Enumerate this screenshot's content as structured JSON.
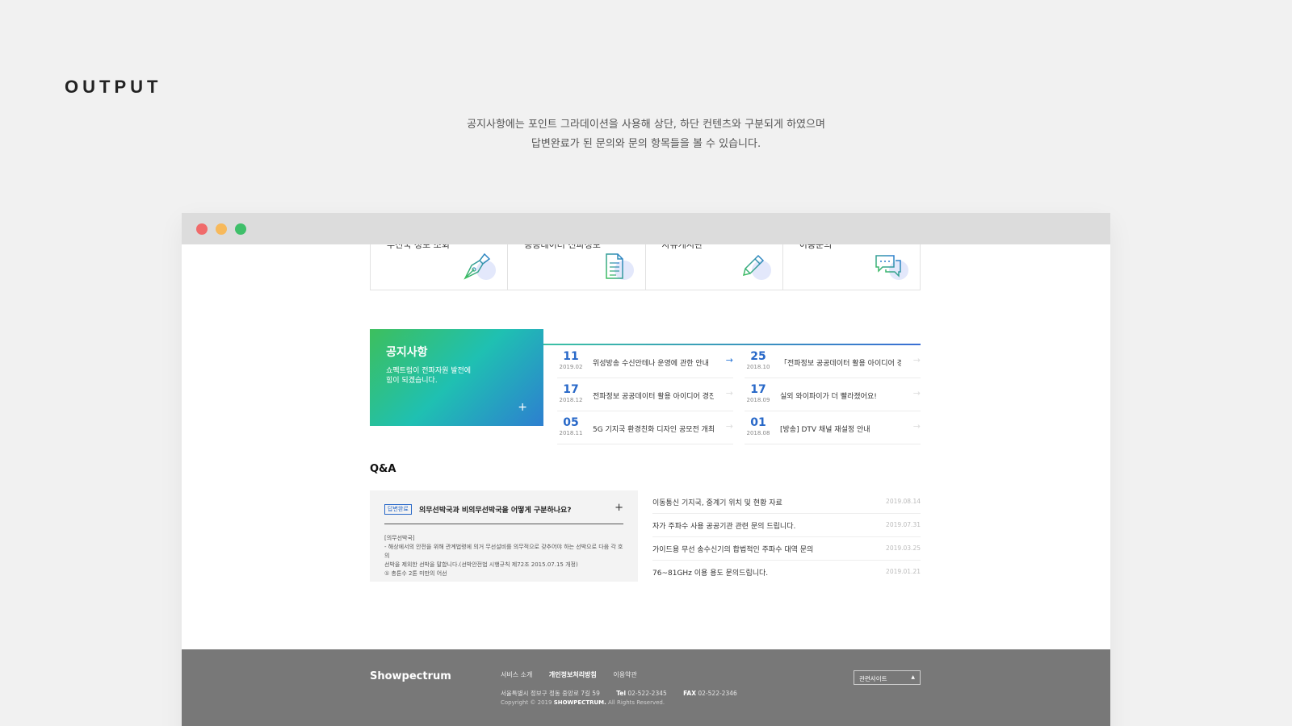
{
  "heading": "OUTPUT",
  "description": {
    "line1": "공지사항에는 포인트 그라데이션을 사용해 상단, 하단 컨텐츠와 구분되게 하였으며",
    "line2": "답변완료가 된 문의와 문의 항목들을 볼 수 있습니다."
  },
  "quick_cards": [
    {
      "label": "무선국 정보 조회",
      "icon": "pen-nib-icon"
    },
    {
      "label": "공공데이터 전파정보",
      "icon": "document-icon"
    },
    {
      "label": "자유게시판",
      "icon": "pencil-icon"
    },
    {
      "label": "이용문의",
      "icon": "chat-bubbles-icon"
    }
  ],
  "notice": {
    "title": "공지사항",
    "subtitle": "쇼펙트럼이 전파자원 발전에 힘이 되겠습니다.",
    "plus": "+",
    "column1": [
      {
        "day": "11",
        "ym": "2019.02",
        "text": "위성방송 수신안테나 운영에 관한 안내",
        "arrow": "→"
      },
      {
        "day": "17",
        "ym": "2018.12",
        "text": "전파정보 공공데이터 활용 아이디어 경진..",
        "arrow": "→"
      },
      {
        "day": "05",
        "ym": "2018.11",
        "text": "5G 기지국 환경친화 디자인 공모전 개최",
        "arrow": "→"
      }
    ],
    "column2": [
      {
        "day": "25",
        "ym": "2018.10",
        "text": "「전파정보 공공데이터 활용 아이디어 경진..",
        "arrow": "→"
      },
      {
        "day": "17",
        "ym": "2018.09",
        "text": "실외 와이파이가 더 빨라졌어요!",
        "arrow": "→"
      },
      {
        "day": "01",
        "ym": "2018.08",
        "text": "[방송] DTV 채널 재설정 안내",
        "arrow": "→"
      }
    ]
  },
  "qa": {
    "title": "Q&A",
    "featured": {
      "badge": "답변완료",
      "question": "의무선박국과 비의무선박국을 어떻게 구분하나요?",
      "plus": "+",
      "body1": "[의무선박국]",
      "body2": "- 해상에서의 안전을 위해 관계법령에 의거 무선설비를 의무적으로 갖추어야 하는 선박으로 다음 각 호의",
      "body3": "선박을 제외한 선박을 말합니다.(선박안전법 시행규칙 제72조 2015.07.15 개정)",
      "body4": "① 총톤수 2톤 미만의 어선"
    },
    "items": [
      {
        "text": "이동통신 기지국, 중계기 위치 및 현황 자료",
        "date": "2019.08.14"
      },
      {
        "text": "자가 주파수 사용 공공기관 관련 문의 드립니다.",
        "date": "2019.07.31"
      },
      {
        "text": "가이드용 무선 송수신기의 합법적인 주파수 대역 문의",
        "date": "2019.03.25"
      },
      {
        "text": "76~81GHz 이용 용도 문의드립니다.",
        "date": "2019.01.21"
      }
    ]
  },
  "footer": {
    "logo": "Showpectrum",
    "links": [
      "서비스 소개",
      "개인정보처리방침",
      "이용약관"
    ],
    "address": "서울특별시 정보구 정동 중앙로 7길 59",
    "tel_label": "Tel",
    "tel": "02-522-2345",
    "fax_label": "FAX",
    "fax": "02-522-2346",
    "copy_prefix": "Copyright © 2019",
    "copy_brand": "SHOWPECTRUM.",
    "copy_suffix": "All Rights Reserved.",
    "related_sites": "관련사이트",
    "caret": "▲"
  },
  "colors": {
    "accent_blue": "#2868c8",
    "gradient_start": "#3dbf5d",
    "gradient_end": "#2d7fd0",
    "footer_bg": "#787878"
  }
}
